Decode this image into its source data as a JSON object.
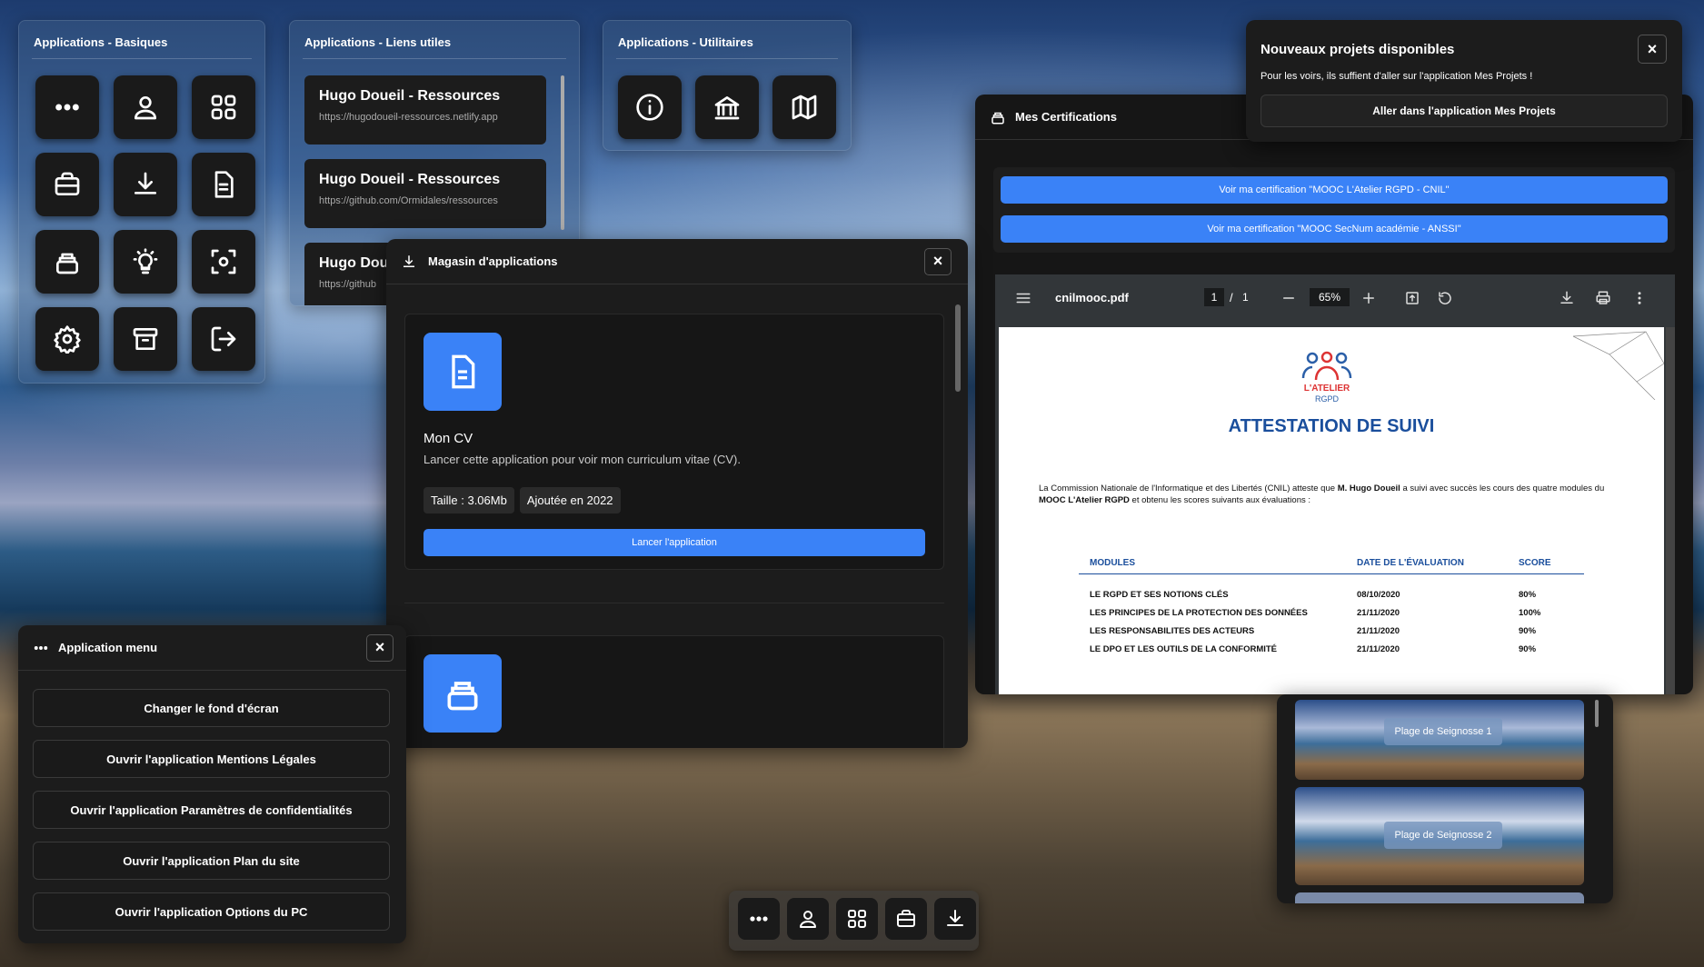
{
  "basics": {
    "title": "Applications - Basiques",
    "icons": [
      "menu-dots-icon",
      "user-icon",
      "grid-icon",
      "briefcase-icon",
      "download-icon",
      "document-icon",
      "archive-stack-icon",
      "lightbulb-icon",
      "scan-icon",
      "gear-icon",
      "archive-box-icon",
      "logout-icon"
    ]
  },
  "links": {
    "title": "Applications - Liens utiles",
    "items": [
      {
        "title": "Hugo Doueil - Ressources",
        "url": "https://hugodoueil-ressources.netlify.app"
      },
      {
        "title": "Hugo Doueil - Ressources",
        "url": "https://github.com/Ormidales/ressources"
      },
      {
        "title": "Hugo Dou",
        "url": "https://github"
      }
    ]
  },
  "utils": {
    "title": "Applications - Utilitaires"
  },
  "store": {
    "title": "Magasin d'applications",
    "app_name": "Mon CV",
    "app_desc": "Lancer cette application pour voir mon curriculum vitae (CV).",
    "size": "Taille : 3.06Mb",
    "added": "Ajoutée en 2022",
    "launch": "Lancer l'application"
  },
  "menu": {
    "title": "Application menu",
    "items": [
      "Changer le fond d'écran",
      "Ouvrir l'application Mentions Légales",
      "Ouvrir l'application Paramètres de confidentialités",
      "Ouvrir l'application Plan du site",
      "Ouvrir l'application Options du PC"
    ]
  },
  "notif": {
    "title": "Nouveaux projets disponibles",
    "text": "Pour les voirs, ils suffient d'aller sur l'application Mes Projets !",
    "button": "Aller dans l'application Mes Projets"
  },
  "certs": {
    "title": "Mes Certifications",
    "btn1": "Voir ma certification \"MOOC L'Atelier RGPD - CNIL\"",
    "btn2": "Voir ma certification \"MOOC SecNum académie - ANSSI\""
  },
  "pdf": {
    "filename": "cnilmooc.pdf",
    "page": "1",
    "pages": "1",
    "zoom": "65%",
    "logo1": "L'ATELIER",
    "logo2": "RGPD",
    "heading": "ATTESTATION DE SUIVI",
    "p1": "La Commission Nationale de l'Informatique et des Libertés (CNIL) atteste que ",
    "name": "M. Hugo Doueil",
    "p2": " a suivi avec succès les cours des quatre modules du ",
    "mooc": "MOOC L'Atelier RGPD",
    "p3": " et obtenu les scores suivants aux évaluations :",
    "cols": [
      "MODULES",
      "DATE DE L'ÉVALUATION",
      "SCORE"
    ],
    "rows": [
      [
        "LE RGPD ET SES NOTIONS CLÉS",
        "08/10/2020",
        "80%"
      ],
      [
        "LES PRINCIPES DE LA PROTECTION DES DONNÉES",
        "21/11/2020",
        "100%"
      ],
      [
        "LES RESPONSABILITES DES ACTEURS",
        "21/11/2020",
        "90%"
      ],
      [
        "LE DPO ET LES OUTILS DE LA CONFORMITÉ",
        "21/11/2020",
        "90%"
      ]
    ]
  },
  "wallpapers": {
    "items": [
      "Plage de Seignosse 1",
      "Plage de Seignosse 2"
    ]
  },
  "dock": {
    "icons": [
      "menu-dots-icon",
      "user-icon",
      "grid-icon",
      "briefcase-icon",
      "download-icon"
    ]
  },
  "colors": {
    "accent": "#3a82f7",
    "window": "#1c1c1c"
  }
}
